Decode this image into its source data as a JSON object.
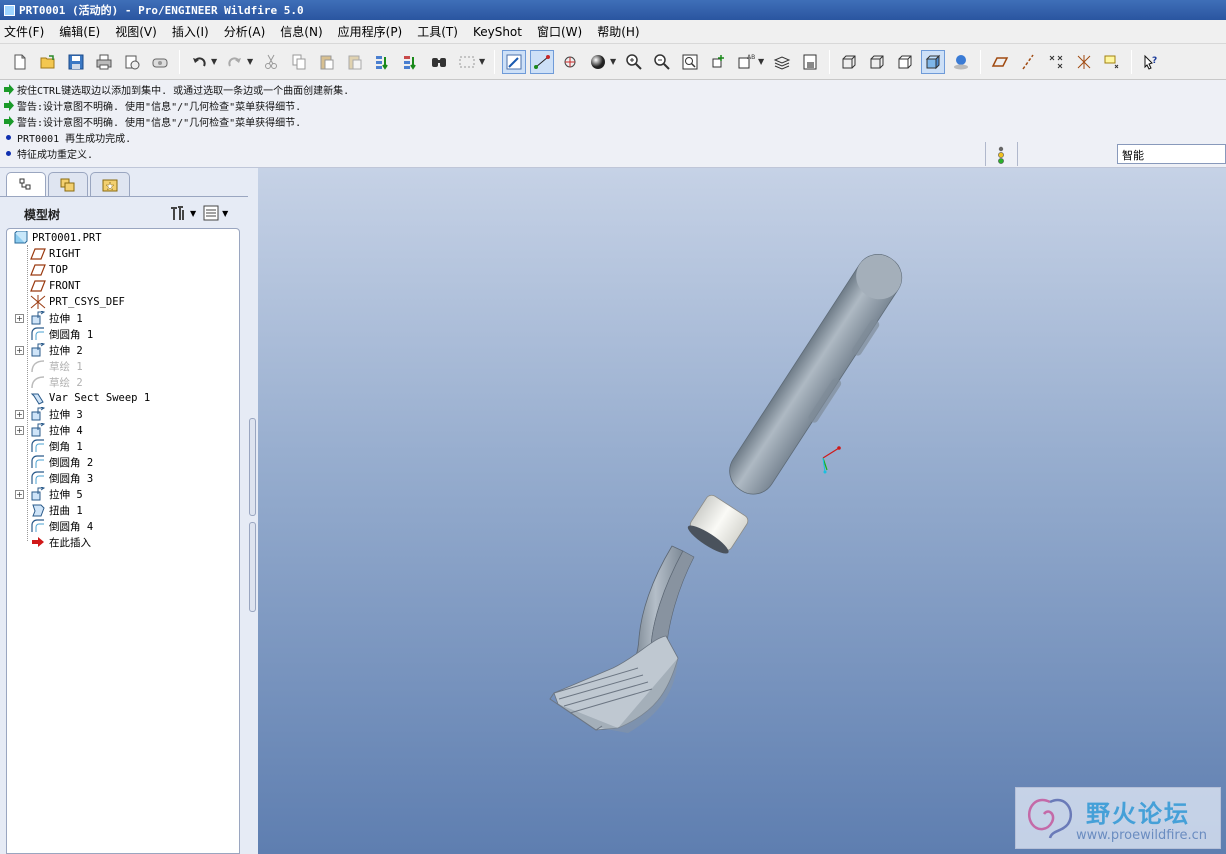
{
  "window": {
    "title": "PRT0001 (活动的) - Pro/ENGINEER Wildfire 5.0"
  },
  "menubar": {
    "items": [
      "文件(F)",
      "编辑(E)",
      "视图(V)",
      "插入(I)",
      "分析(A)",
      "信息(N)",
      "应用程序(P)",
      "工具(T)",
      "KeyShot",
      "窗口(W)",
      "帮助(H)"
    ]
  },
  "toolbar": {
    "icons": [
      "new-icon",
      "open-icon",
      "save-icon",
      "print-icon",
      "mail-icon",
      "mail-attach-icon",
      "undo-icon",
      "redo-icon",
      "cut-icon",
      "copy-icon",
      "paste-icon",
      "paste-special-icon",
      "regenerate-icon",
      "regen-manager-icon",
      "find-icon",
      "select-box-icon",
      "repaint-icon",
      "spin-center-icon",
      "orient-mode-icon",
      "appearance-icon",
      "zoom-in-icon",
      "zoom-out-icon",
      "refit-icon",
      "reorient-icon",
      "saved-views-icon",
      "layers-icon",
      "view-manager-icon",
      "wireframe-icon",
      "hidden-line-icon",
      "no-hidden-icon",
      "shading-icon",
      "enhanced-realism-icon",
      "datum-planes-icon",
      "datum-axes-icon",
      "datum-points-icon",
      "csys-icon",
      "annotations-icon",
      "context-help-icon"
    ]
  },
  "messages": [
    {
      "type": "prompt",
      "text": "按住CTRL键选取边以添加到集中. 或通过选取一条边或一个曲面创建新集."
    },
    {
      "type": "warning",
      "text": "警告:设计意图不明确. 使用\"信息\"/\"几何检查\"菜单获得细节."
    },
    {
      "type": "warning",
      "text": "警告:设计意图不明确. 使用\"信息\"/\"几何检查\"菜单获得细节."
    },
    {
      "type": "info",
      "text": "PRT0001 再生成功完成."
    },
    {
      "type": "info",
      "text": "特征成功重定义."
    }
  ],
  "filter": {
    "value": "智能"
  },
  "colors": {
    "titlebar": "#2a55a0",
    "graphics_top": "#c6d2e6",
    "graphics_bottom": "#5e7eb0",
    "model": "#8d9aa6"
  },
  "model_tree": {
    "title": "模型树",
    "nodes": [
      {
        "label": "PRT0001.PRT",
        "icon": "part-icon",
        "expandable": false,
        "dimmed": false
      },
      {
        "label": "RIGHT",
        "icon": "datum-plane-icon",
        "expandable": false,
        "dimmed": false
      },
      {
        "label": "TOP",
        "icon": "datum-plane-icon",
        "expandable": false,
        "dimmed": false
      },
      {
        "label": "FRONT",
        "icon": "datum-plane-icon",
        "expandable": false,
        "dimmed": false
      },
      {
        "label": "PRT_CSYS_DEF",
        "icon": "csys-icon",
        "expandable": false,
        "dimmed": false
      },
      {
        "label": "拉伸 1",
        "icon": "extrude-icon",
        "expandable": true,
        "dimmed": false
      },
      {
        "label": "倒圆角 1",
        "icon": "round-icon",
        "expandable": false,
        "dimmed": false
      },
      {
        "label": "拉伸 2",
        "icon": "extrude-icon",
        "expandable": true,
        "dimmed": false
      },
      {
        "label": "草绘 1",
        "icon": "sketch-icon",
        "expandable": false,
        "dimmed": true
      },
      {
        "label": "草绘 2",
        "icon": "sketch-icon",
        "expandable": false,
        "dimmed": true
      },
      {
        "label": "Var Sect Sweep 1",
        "icon": "sweep-icon",
        "expandable": false,
        "dimmed": false
      },
      {
        "label": "拉伸 3",
        "icon": "extrude-icon",
        "expandable": true,
        "dimmed": false
      },
      {
        "label": "拉伸 4",
        "icon": "extrude-icon",
        "expandable": true,
        "dimmed": false
      },
      {
        "label": "倒角 1",
        "icon": "round-icon",
        "expandable": false,
        "dimmed": false
      },
      {
        "label": "倒圆角 2",
        "icon": "round-icon",
        "expandable": false,
        "dimmed": false
      },
      {
        "label": "倒圆角 3",
        "icon": "round-icon",
        "expandable": false,
        "dimmed": false
      },
      {
        "label": "拉伸 5",
        "icon": "extrude-icon",
        "expandable": true,
        "dimmed": false
      },
      {
        "label": "扭曲 1",
        "icon": "warp-icon",
        "expandable": false,
        "dimmed": false
      },
      {
        "label": "倒圆角 4",
        "icon": "round-icon",
        "expandable": false,
        "dimmed": false
      },
      {
        "label": "在此插入",
        "icon": "insert-here-icon",
        "expandable": false,
        "dimmed": false
      }
    ]
  },
  "watermark": {
    "title": "野火论坛",
    "url": "www.proewildfire.cn"
  }
}
